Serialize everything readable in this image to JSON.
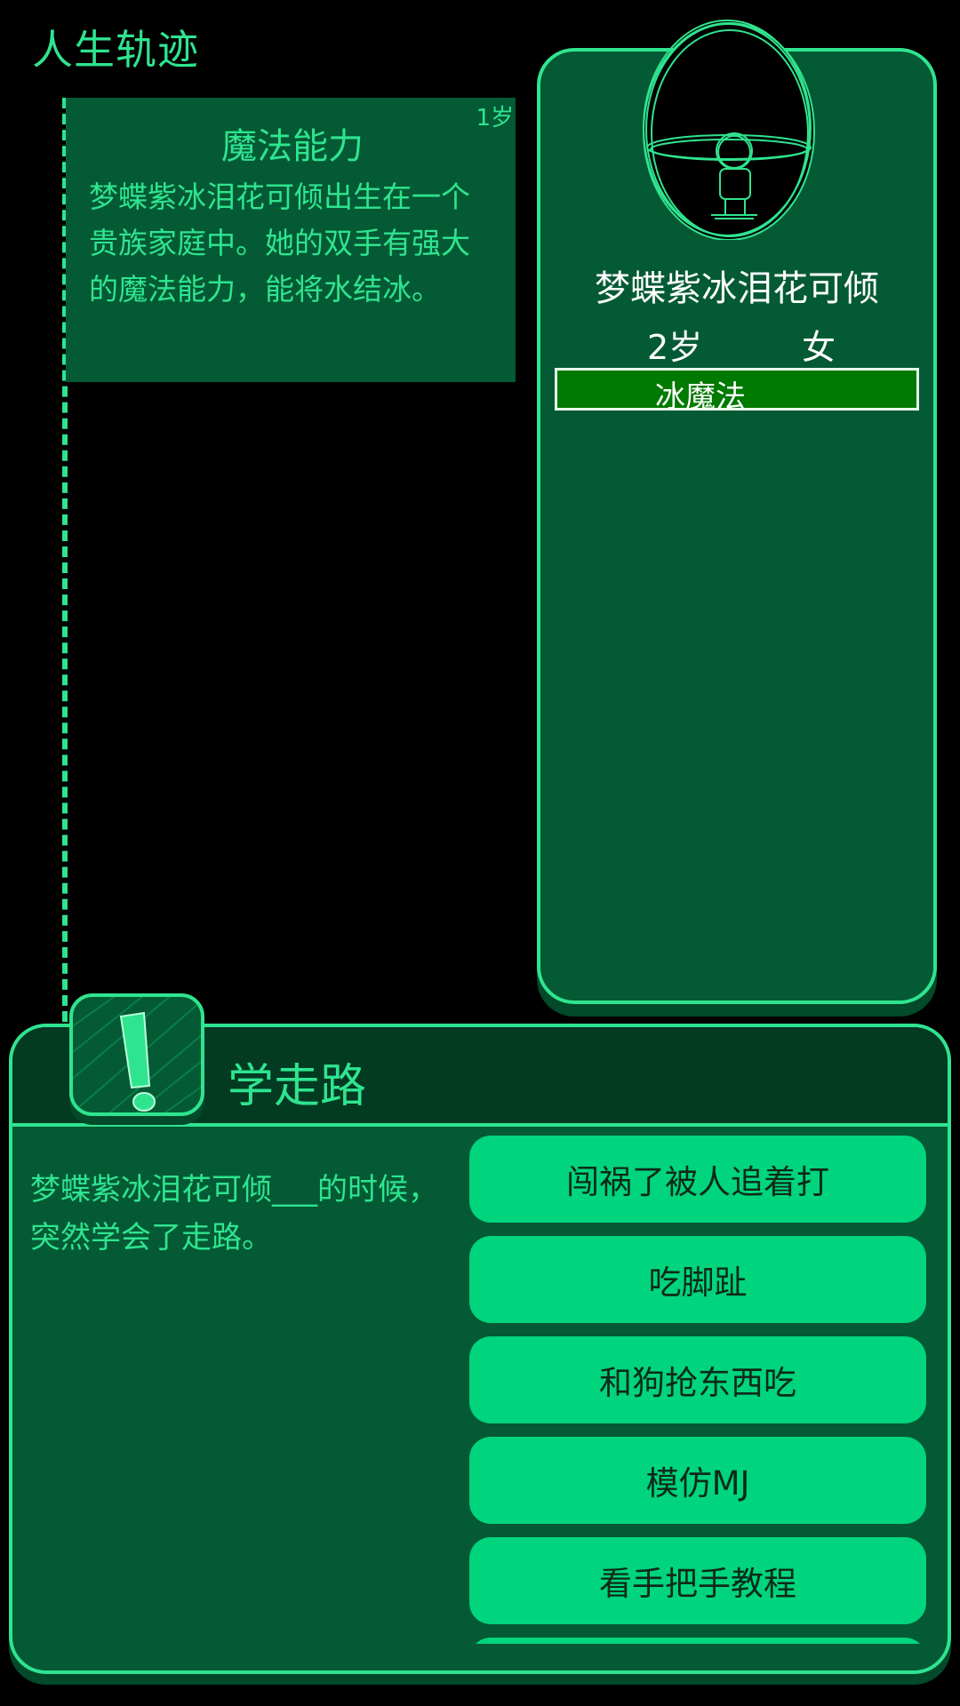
{
  "header": {
    "title": "人生轨迹"
  },
  "timeline": {
    "events": [
      {
        "age": "1岁",
        "title": "魔法能力",
        "text": "梦蝶紫冰泪花可倾出生在一个贵族家庭中。她的双手有强大的魔法能力，能将水结冰。"
      }
    ]
  },
  "character": {
    "avatar_icon": "character-egg-avatar-icon",
    "name": "梦蝶紫冰泪花可倾",
    "age": "2岁",
    "gender": "女",
    "traits": [
      "冰魔法"
    ]
  },
  "event_panel": {
    "icon": "exclamation-icon",
    "title": "学走路",
    "description": "梦蝶紫冰泪花可倾___的时候，突然学会了走路。",
    "choices": [
      "闯祸了被人追着打",
      "吃脚趾",
      "和狗抢东西吃",
      "模仿MJ",
      "看手把手教程"
    ]
  },
  "colors": {
    "accent": "#2fe48f",
    "panel": "#045a34",
    "button": "#00d47d",
    "trait": "#007a00"
  }
}
